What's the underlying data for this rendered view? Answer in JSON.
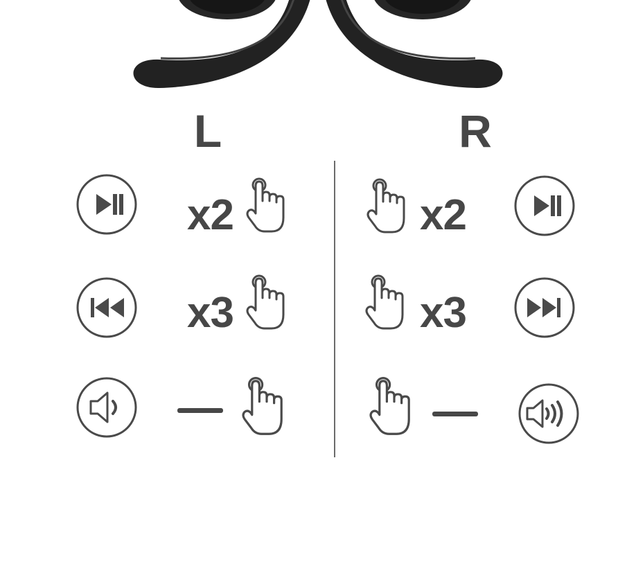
{
  "sides": {
    "left": {
      "label": "L"
    },
    "right": {
      "label": "R"
    }
  },
  "controls": {
    "left": [
      {
        "action_icon": "play-pause-icon",
        "count": "x2"
      },
      {
        "action_icon": "previous-track-icon",
        "count": "x3"
      },
      {
        "action_icon": "volume-down-icon",
        "count": "—"
      }
    ],
    "right": [
      {
        "action_icon": "play-pause-icon",
        "count": "x2"
      },
      {
        "action_icon": "next-track-icon",
        "count": "x3"
      },
      {
        "action_icon": "volume-up-icon",
        "count": "—"
      }
    ]
  },
  "colors": {
    "icon_stroke": "#4a4a4a",
    "text": "#474747",
    "earbud": "#1e1e1e"
  }
}
